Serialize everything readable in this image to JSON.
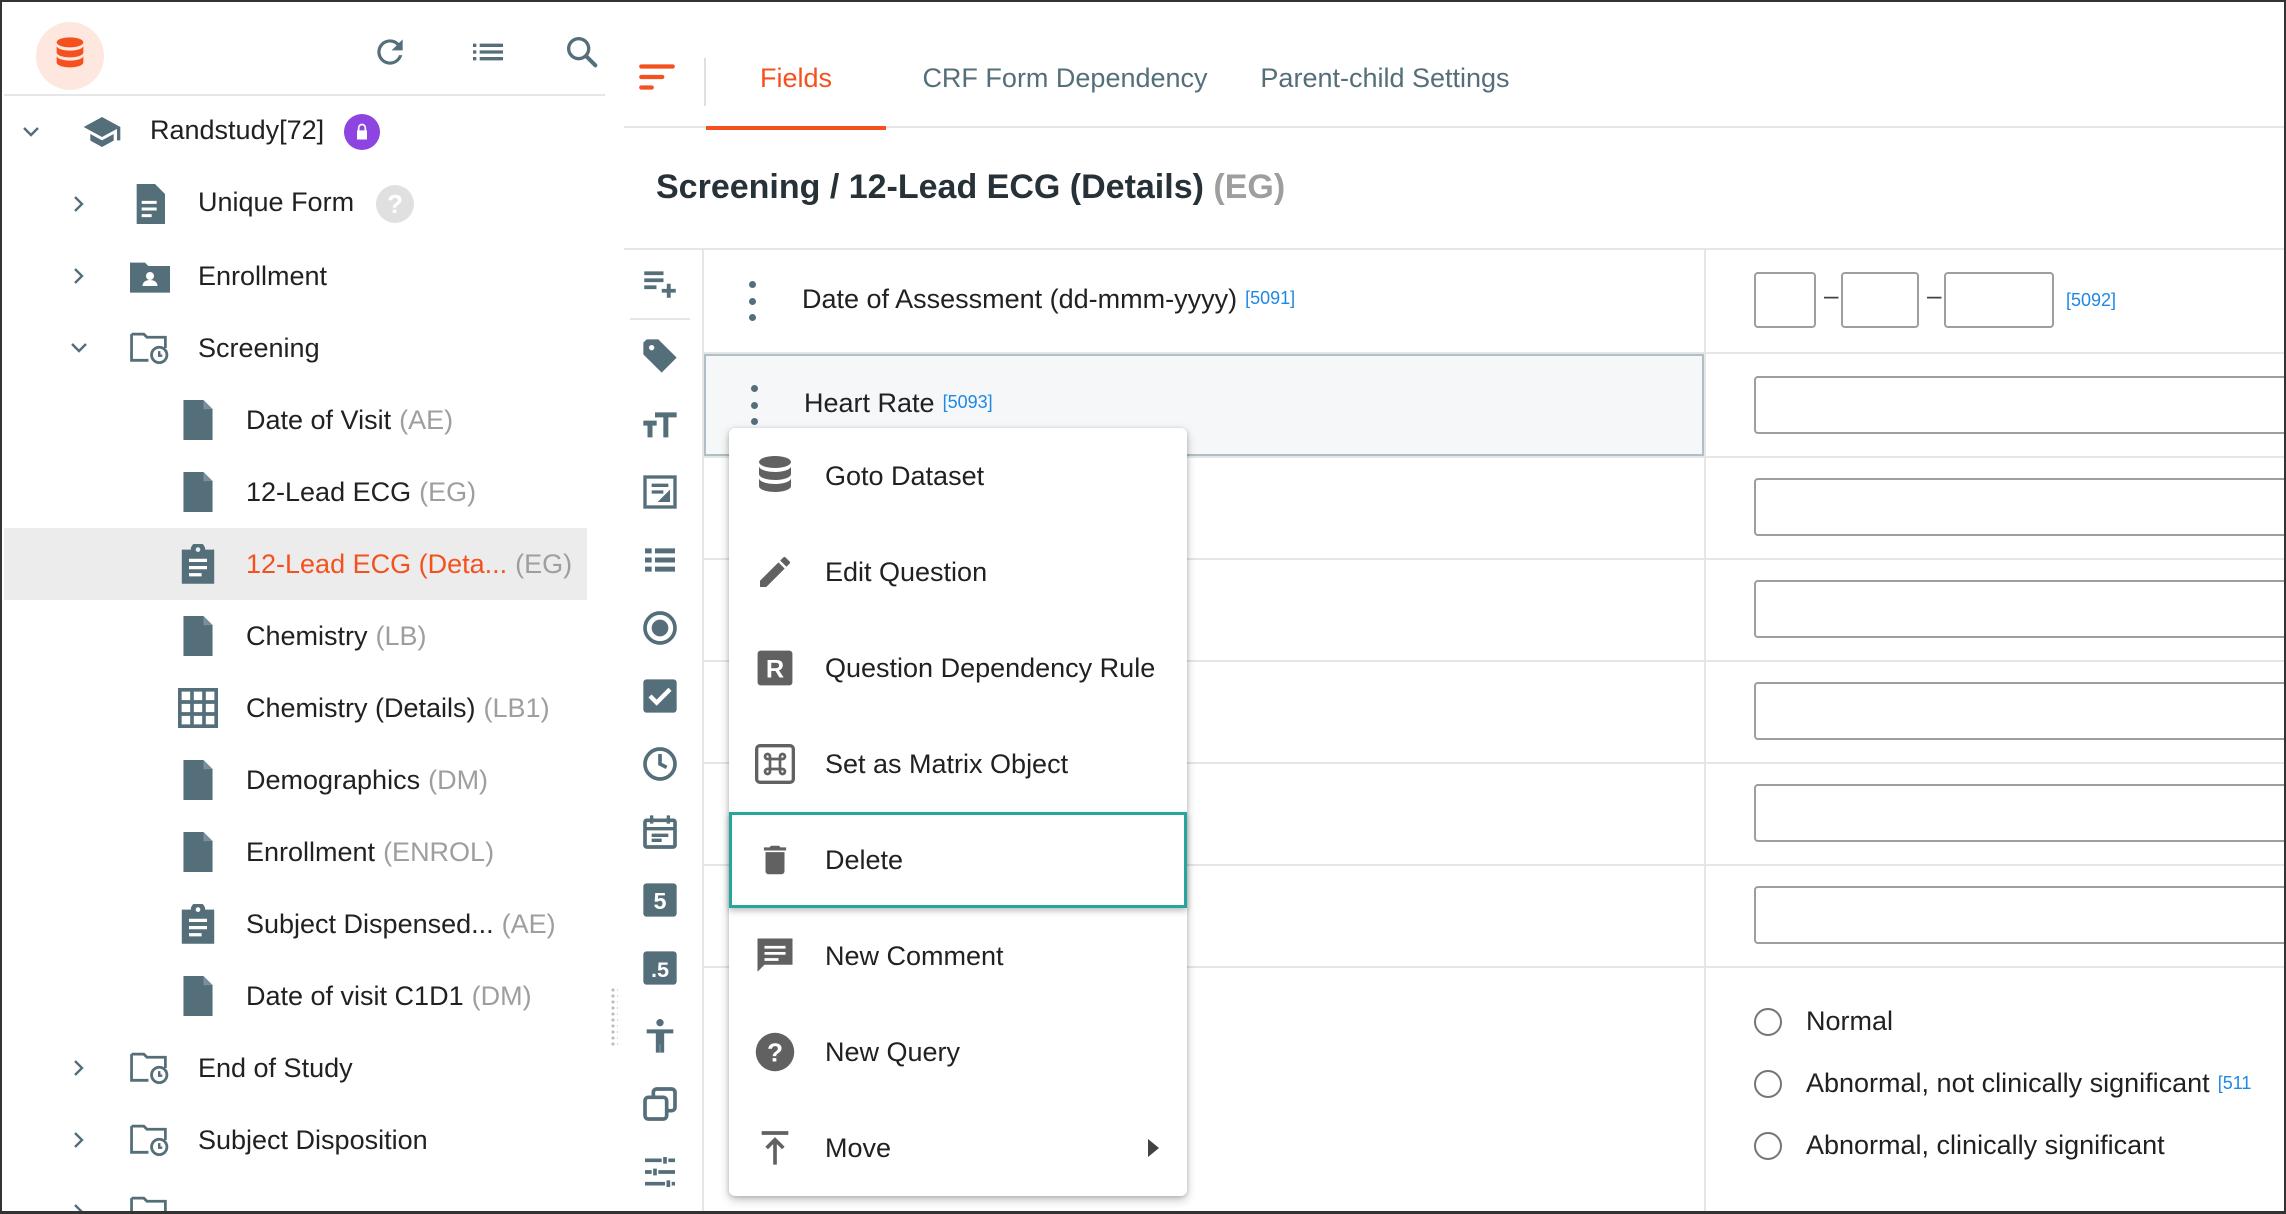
{
  "sidebar": {
    "tree": [
      {
        "label": "Randstudy[72]",
        "code": "",
        "icon": "study-cap-icon",
        "expanded": true
      },
      {
        "label": "Unique Form",
        "code": "",
        "icon": "form-doc-icon"
      },
      {
        "label": "Enrollment",
        "code": "",
        "icon": "folder-person-icon"
      },
      {
        "label": "Screening",
        "code": "",
        "icon": "folder-clock-icon",
        "expanded": true
      },
      {
        "label": "Date of Visit",
        "code": "(AE)",
        "icon": "file-icon"
      },
      {
        "label": "12-Lead ECG",
        "code": "(EG)",
        "icon": "file-icon"
      },
      {
        "label": "12-Lead ECG (Deta...",
        "code": "(EG)",
        "icon": "clipboard-icon",
        "selected": true
      },
      {
        "label": "Chemistry",
        "code": "(LB)",
        "icon": "file-icon"
      },
      {
        "label": "Chemistry (Details)",
        "code": "(LB1)",
        "icon": "grid-icon"
      },
      {
        "label": "Demographics",
        "code": "(DM)",
        "icon": "file-icon"
      },
      {
        "label": "Enrollment",
        "code": "(ENROL)",
        "icon": "file-icon"
      },
      {
        "label": "Subject Dispensed...",
        "code": "(AE)",
        "icon": "clipboard-icon"
      },
      {
        "label": "Date of visit C1D1",
        "code": "(DM)",
        "icon": "file-icon"
      },
      {
        "label": "End of Study",
        "code": "",
        "icon": "folder-clock-icon"
      },
      {
        "label": "Subject Disposition",
        "code": "",
        "icon": "folder-clock-icon"
      }
    ]
  },
  "tabs": [
    {
      "label": "Fields",
      "active": true
    },
    {
      "label": "CRF Form Dependency"
    },
    {
      "label": "Parent-child Settings"
    }
  ],
  "form": {
    "title": "Screening / 12-Lead ECG (Details)",
    "title_code": "(EG)",
    "questions": [
      {
        "label": "Date of Assessment (dd-mmm-yyyy)",
        "id": "[5091]",
        "answer_id": "[5092]"
      },
      {
        "label": "Heart Rate",
        "id": "[5093]"
      }
    ],
    "date_separator": "–",
    "radio_options": [
      "Normal",
      "Abnormal, not clinically significant",
      "Abnormal, clinically significant"
    ],
    "radio_id": "[511"
  },
  "context_menu": {
    "items": [
      {
        "label": "Goto Dataset",
        "icon": "database-icon"
      },
      {
        "label": "Edit Question",
        "icon": "pencil-icon"
      },
      {
        "label": "Question Dependency Rule",
        "icon": "rule-r-icon"
      },
      {
        "label": "Set as Matrix Object",
        "icon": "command-icon"
      },
      {
        "label": "Delete",
        "icon": "trash-icon",
        "highlighted": true
      },
      {
        "label": "New Comment",
        "icon": "comment-icon"
      },
      {
        "label": "New Query",
        "icon": "help-circle-icon"
      },
      {
        "label": "Move",
        "icon": "move-up-icon",
        "submenu": true
      }
    ]
  },
  "colors": {
    "accent": "#f4511e",
    "selected_bg": "#ececec",
    "link_blue": "#1e88e5",
    "teal_highlight": "#26a69a",
    "icon_gray": "#546e7a"
  }
}
